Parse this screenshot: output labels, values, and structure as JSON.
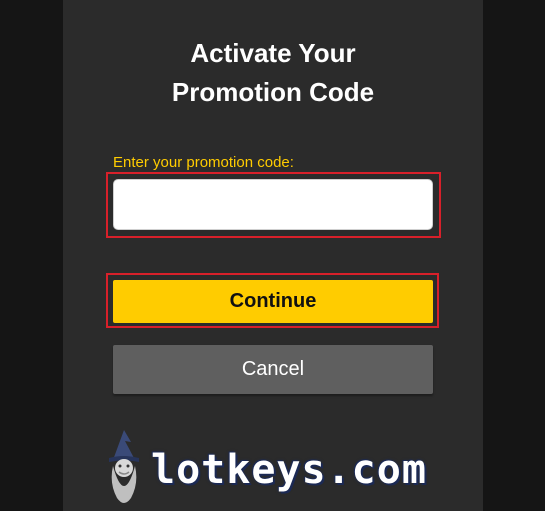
{
  "dialog": {
    "title_line1": "Activate Your",
    "title_line2": "Promotion Code"
  },
  "promo_field": {
    "label": "Enter your promotion code:",
    "value": ""
  },
  "buttons": {
    "continue_label": "Continue",
    "cancel_label": "Cancel"
  },
  "watermark": {
    "text": "lotkeys.com",
    "icon": "wizard-icon"
  },
  "colors": {
    "accent": "#ffcc00",
    "highlight": "#d8202a",
    "panel": "#2b2b2b",
    "cancel": "#5f5f5f"
  }
}
